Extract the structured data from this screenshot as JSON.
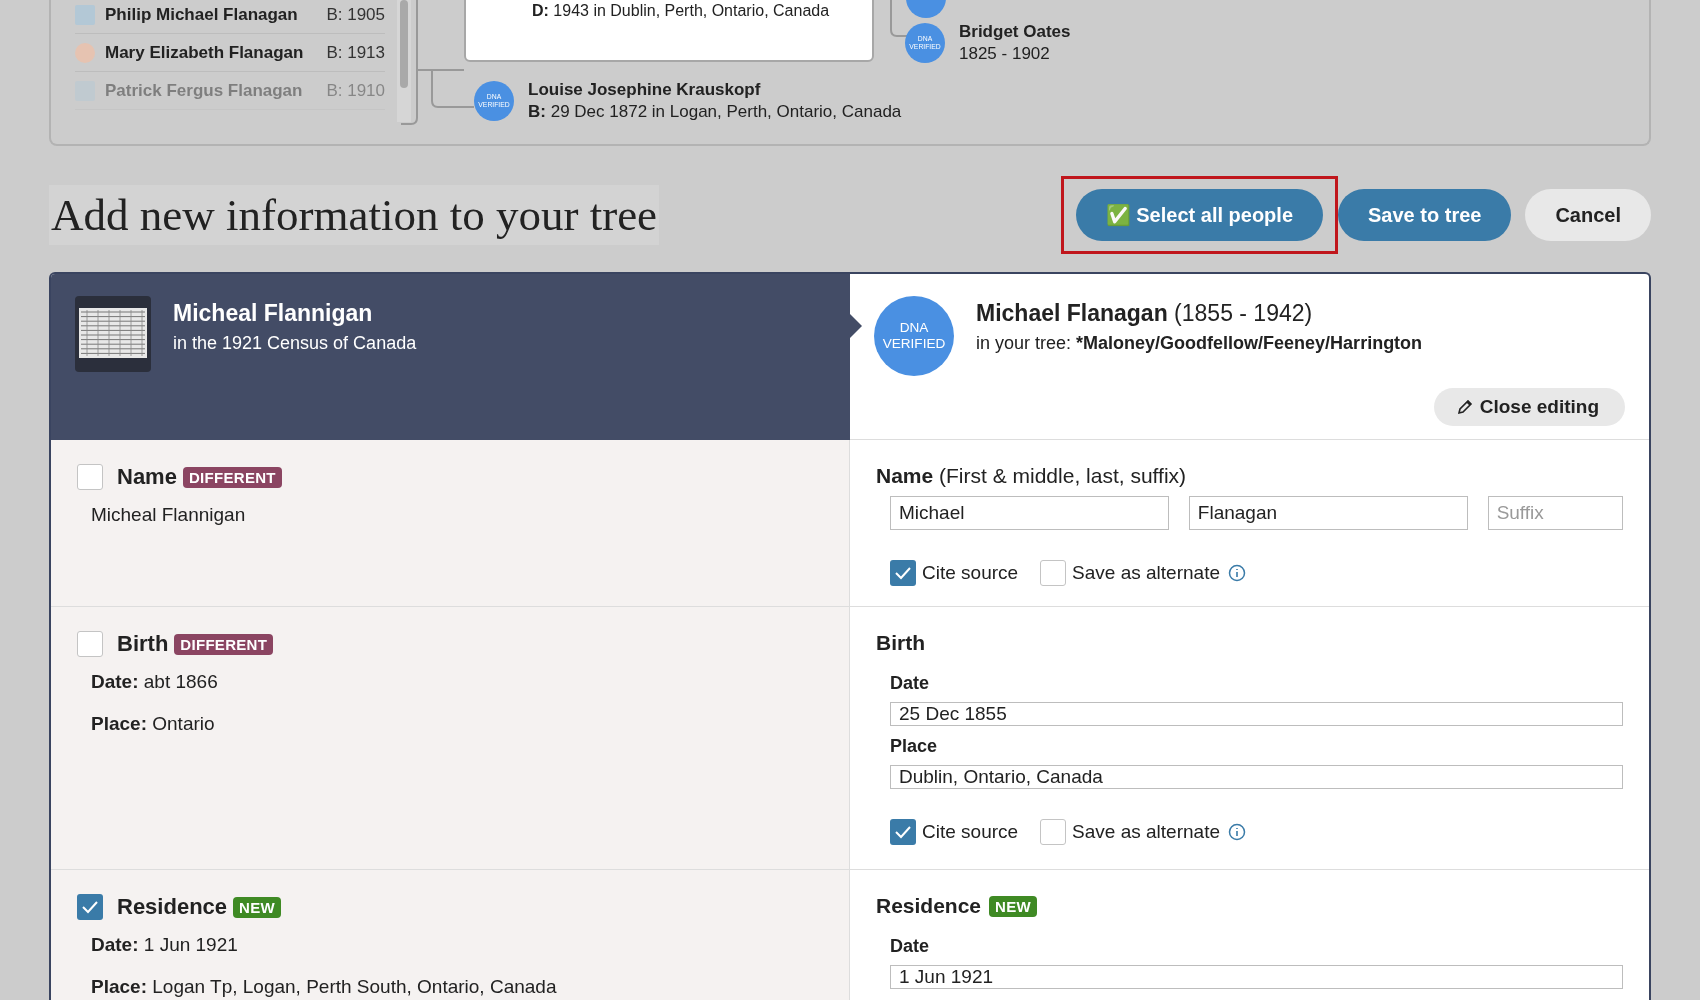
{
  "family_list": [
    {
      "name": "Philip Michael Flanagan",
      "birth": "B: 1905",
      "kind": "male",
      "faded": false
    },
    {
      "name": "Mary Elizabeth Flanagan",
      "birth": "B: 1913",
      "kind": "female",
      "faded": false
    },
    {
      "name": "Patrick Fergus Flanagan",
      "birth": "B: 1910",
      "kind": "male",
      "faded": true
    }
  ],
  "tree": {
    "father": {
      "label": "D:",
      "text": "1943 in Dublin, Perth, Ontario, Canada"
    },
    "mother": {
      "badge": [
        "DNA",
        "VERIFIED"
      ],
      "name": "Louise Josephine Krauskopf",
      "label": "B:",
      "text": "29 Dec 1872 in Logan, Perth, Ontario, Canada"
    },
    "grandmother": {
      "badge": [
        "DNA",
        "VERIFIED"
      ],
      "name": "Bridget Oates",
      "years": "1825 - 1902"
    }
  },
  "page_title": "Add new information to your tree",
  "actions": [
    {
      "kind": "primary",
      "icon": "✅",
      "label": "Select all people",
      "highlighted": true
    },
    {
      "kind": "primary",
      "label": "Save to tree",
      "highlighted": false
    },
    {
      "kind": "secondary",
      "label": "Cancel",
      "highlighted": false
    }
  ],
  "record": {
    "name": "Micheal Flannigan",
    "source": "in the 1921 Census of Canada"
  },
  "tree_person": {
    "badge": [
      "DNA",
      "VERIFIED"
    ],
    "name": "Michael Flanagan",
    "years": "(1855 - 1942)",
    "tree_label": "in your tree:",
    "tree_name": "*Maloney/Goodfellow/Feeney/Harrington",
    "close_editing": "Close editing"
  },
  "facts": [
    {
      "label": "Name",
      "checked": false,
      "tag": {
        "text": "DIFFERENT",
        "kind": "different"
      },
      "details": [
        {
          "value": "Micheal Flannigan"
        }
      ],
      "edit": {
        "kind": "inline",
        "title": "Name",
        "hint": "(First & middle, last, suffix)",
        "fields": [
          {
            "value": "Michael"
          },
          {
            "value": "Flanagan"
          },
          {
            "placeholder": "Suffix"
          }
        ],
        "options": [
          {
            "label": "Cite source",
            "checked": true,
            "info": false
          },
          {
            "label": "Save as alternate",
            "checked": false,
            "info": true
          }
        ]
      }
    },
    {
      "label": "Birth",
      "checked": false,
      "tag": {
        "text": "DIFFERENT",
        "kind": "different"
      },
      "details": [
        {
          "label": "Date:",
          "value": "abt 1866"
        },
        {
          "label": "Place:",
          "value": "Ontario"
        }
      ],
      "edit": {
        "kind": "stacked",
        "title": "Birth",
        "fields": [
          {
            "label": "Date",
            "value": "25 Dec 1855"
          },
          {
            "label": "Place",
            "value": "Dublin, Ontario, Canada"
          }
        ],
        "options": [
          {
            "label": "Cite source",
            "checked": true,
            "info": false
          },
          {
            "label": "Save as alternate",
            "checked": false,
            "info": true
          }
        ]
      }
    },
    {
      "label": "Residence",
      "checked": true,
      "tag": {
        "text": "NEW",
        "kind": "new"
      },
      "details": [
        {
          "label": "Date:",
          "value": "1 Jun 1921"
        },
        {
          "label": "Place:",
          "value": "Logan Tp, Logan, Perth South, Ontario, Canada"
        }
      ],
      "edit": {
        "kind": "stacked",
        "title": "Residence",
        "tag": {
          "text": "NEW",
          "kind": "new"
        },
        "fields": [
          {
            "label": "Date",
            "value": "1 Jun 1921"
          }
        ]
      }
    }
  ]
}
